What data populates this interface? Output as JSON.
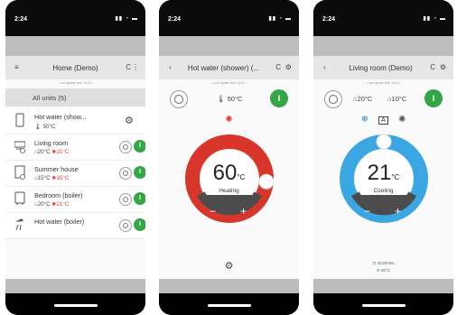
{
  "phones": [
    {
      "time": "2:24",
      "header": {
        "title": "Home (Demo)",
        "left_icon": "hamburger-menu-icon",
        "refresh": "C",
        "more": "⋮"
      },
      "last_update": "– Last update time 14:24 –",
      "all_units": "All units (5)",
      "units": [
        {
          "name": "Hot water (show...",
          "temps": [
            "🌡 50°C"
          ],
          "icon": "water-tank-icon",
          "control": "remote-settings-icon"
        },
        {
          "name": "Living room",
          "temps": [
            "⌂20°C",
            "✺21°C"
          ],
          "icon": "air-conditioner-icon",
          "control": "power"
        },
        {
          "name": "Summer house",
          "temps": [
            "⌂15°C",
            "✺15°C"
          ],
          "icon": "indoor-unit-icon",
          "control": "power"
        },
        {
          "name": "Bedroom (boiler)",
          "temps": [
            "⌂20°C",
            "✺21°C"
          ],
          "icon": "boiler-icon",
          "control": "power"
        },
        {
          "name": "Hot water (boiler)",
          "temps": [],
          "icon": "shower-icon",
          "control": "power"
        }
      ],
      "on_label": "I"
    },
    {
      "time": "2:24",
      "header": {
        "title": "Hot water (shower) (...",
        "back": "‹",
        "refresh": "C",
        "settings": "⚙"
      },
      "last_update": "– Last update time 14:24 –",
      "current": "🌡 50°C",
      "mode_icon": "sun-heating-icon",
      "setpoint": "60",
      "unit": "°C",
      "mode_label": "Heating",
      "minus": "−",
      "plus": "+",
      "on_label": "I",
      "ring_color": "#d9362b",
      "dial_level": 0.85
    },
    {
      "time": "2:24",
      "header": {
        "title": "Living room (Demo)",
        "back": "‹",
        "refresh": "C",
        "settings": "⚙"
      },
      "last_update": "– Last update time 14:24 –",
      "current_in": "⌂20°C",
      "current_out": "⌂10°C",
      "mode_icons": [
        "snowflake-icon",
        "auto-mode-icon",
        "sun-icon"
      ],
      "auto_label": "A",
      "setpoint": "21",
      "unit": "°C",
      "mode_label": "Cooling",
      "minus": "−",
      "plus": "+",
      "on_label": "I",
      "ring_color": "#3aa7e3",
      "schedule_time": "10:00 Mo",
      "schedule_temp": "20°C",
      "dial_level": 0.5
    }
  ]
}
